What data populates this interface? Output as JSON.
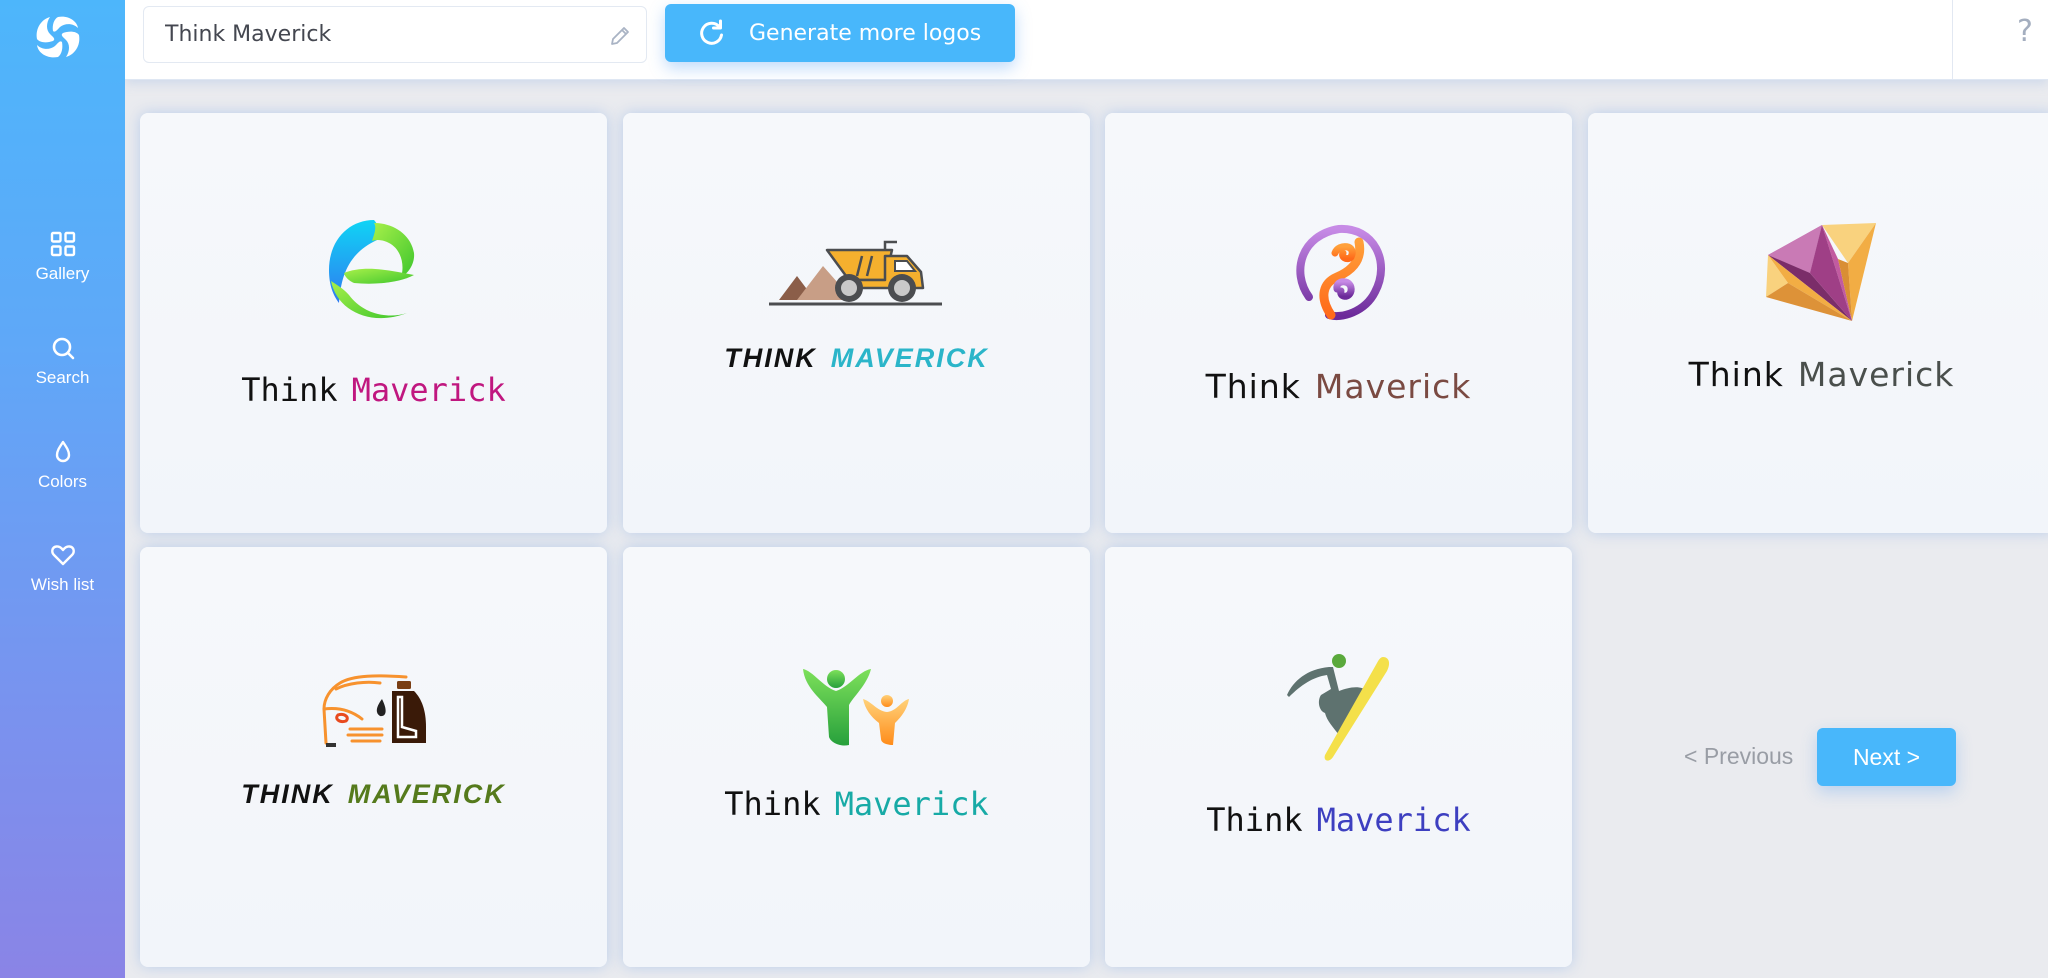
{
  "sidebar": {
    "brand_icon": "swirl-logo-icon",
    "items": [
      {
        "label": "Gallery",
        "icon": "grid-icon"
      },
      {
        "label": "Search",
        "icon": "search-icon"
      },
      {
        "label": "Colors",
        "icon": "droplet-icon"
      },
      {
        "label": "Wish list",
        "icon": "heart-icon"
      }
    ]
  },
  "topbar": {
    "business_name_value": "Think Maverick",
    "edit_icon": "pencil-icon",
    "generate_label": "Generate more logos",
    "generate_icon": "refresh-icon",
    "help_label": "?"
  },
  "logos": [
    {
      "word1": "Think",
      "word2": "Maverick",
      "word1_color": "#111111",
      "word2_color": "#c0177f",
      "icon": "leaf-e-icon"
    },
    {
      "word1": "THINK",
      "word2": "MAVERICK",
      "word1_color": "#111111",
      "word2_color": "#2bb5c9",
      "icon": "dump-truck-icon"
    },
    {
      "word1": "Think",
      "word2": "Maverick",
      "word1_color": "#111111",
      "word2_color": "#7a4a42",
      "icon": "yin-yang-swirl-icon"
    },
    {
      "word1": "Think",
      "word2": "Maverick",
      "word1_color": "#111111",
      "word2_color": "#4a4f4c",
      "icon": "gem-icon"
    },
    {
      "word1": "THINK",
      "word2": "MAVERICK",
      "word1_color": "#111111",
      "word2_color": "#557a1c",
      "icon": "car-oil-icon"
    },
    {
      "word1": "Think",
      "word2": "Maverick",
      "word1_color": "#111111",
      "word2_color": "#17aaa6",
      "icon": "people-cheer-icon"
    },
    {
      "word1": "Think",
      "word2": "Maverick",
      "word1_color": "#111111",
      "word2_color": "#3d3fc0",
      "icon": "snowboarder-icon"
    }
  ],
  "pagination": {
    "previous_label": "< Previous",
    "next_label": "Next >"
  },
  "colors": {
    "accent": "#48b7fb",
    "sidebar_top": "#4db6fb",
    "sidebar_bottom": "#8a84e6"
  }
}
